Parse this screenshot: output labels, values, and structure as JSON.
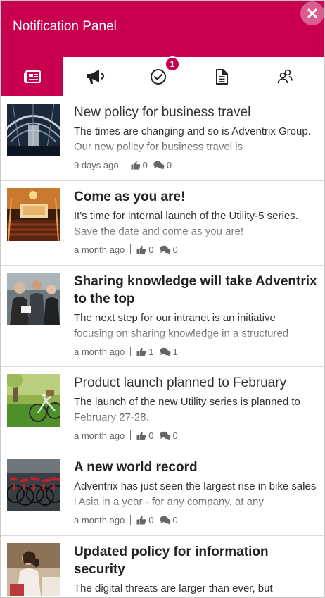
{
  "header": {
    "title": "Notification Panel",
    "close_icon": "close-icon",
    "accent_color": "#c8004f"
  },
  "tabs": [
    {
      "name": "news",
      "icon": "newspaper-icon",
      "active": true
    },
    {
      "name": "announcements",
      "icon": "megaphone-icon",
      "active": false
    },
    {
      "name": "tasks",
      "icon": "check-circle-icon",
      "active": false,
      "badge": "1"
    },
    {
      "name": "documents",
      "icon": "document-icon",
      "active": false
    },
    {
      "name": "people",
      "icon": "people-icon",
      "active": false
    }
  ],
  "news": [
    {
      "title": "New policy for business travel",
      "excerpt": "The times are changing and so is Adventrix Group. Our new policy for business travel is",
      "time": "9 days ago",
      "likes": "0",
      "comments": "0",
      "image": "train-station-photo"
    },
    {
      "title": "Come as you are!",
      "excerpt": "It's time for internal launch of the Utility-5 series. Save the date and come as you are!",
      "time": "a month ago",
      "likes": "0",
      "comments": "0",
      "image": "auditorium-photo"
    },
    {
      "title": "Sharing knowledge will take Adventrix to the top",
      "excerpt": "The next step for our intranet is an initiative focusing on sharing knowledge in a structured",
      "time": "a month ago",
      "likes": "1",
      "comments": "1",
      "image": "team-meeting-photo"
    },
    {
      "title": "Product launch planned to February",
      "excerpt": "The launch of the new Utility series is planned to February 27-28.",
      "time": "a month ago",
      "likes": "0",
      "comments": "0",
      "image": "bicycle-on-grass-photo"
    },
    {
      "title": "A new world record",
      "excerpt": "Adventrix has just seen the largest rise in bike sales i Asia in a year - for any company, at any",
      "time": "a month ago",
      "likes": "0",
      "comments": "0",
      "image": "bike-rack-photo"
    },
    {
      "title": "Updated policy for information security",
      "excerpt": "The digital threats are larger than ever, but",
      "time": "",
      "likes": "",
      "comments": "",
      "image": "woman-on-phone-photo"
    }
  ]
}
